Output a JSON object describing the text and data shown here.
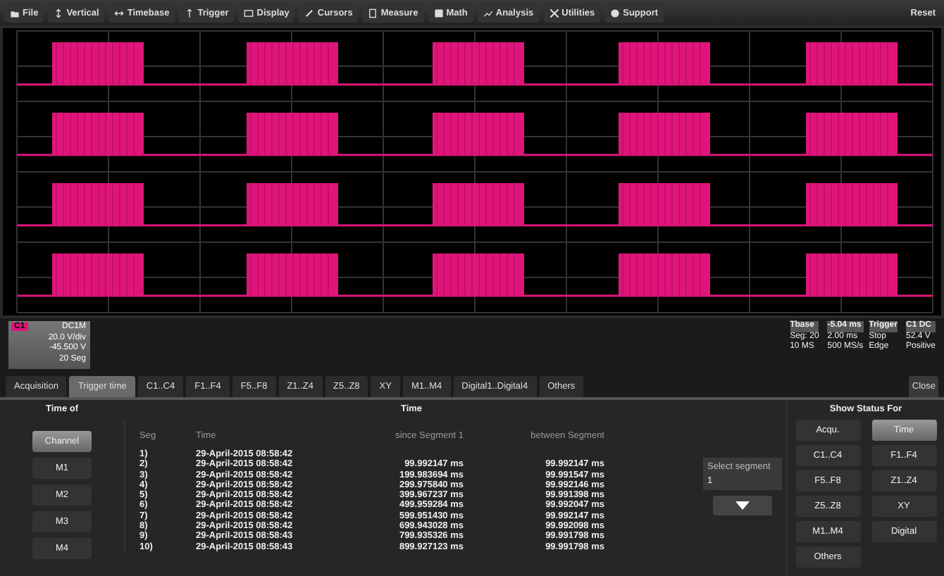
{
  "menu": [
    "File",
    "Vertical",
    "Timebase",
    "Trigger",
    "Display",
    "Cursors",
    "Measure",
    "Math",
    "Analysis",
    "Utilities",
    "Support"
  ],
  "reset": "Reset",
  "traces": [
    {
      "color": "#e0157a"
    },
    {
      "color": "#e0157a"
    },
    {
      "color": "#e0157a"
    },
    {
      "color": "#e0157a"
    }
  ],
  "channel": {
    "badge": "C1",
    "color": "#e0157a",
    "lines": [
      "DC1M",
      "20.0 V/div",
      "-45.500 V",
      "20 Seg"
    ]
  },
  "timebase": {
    "rows": [
      [
        "Tbase",
        "-5.04 ms"
      ],
      [
        "Seg: 20",
        "2.00 ms"
      ],
      [
        "10 MS",
        "500 MS/s"
      ]
    ]
  },
  "trigger": {
    "rows": [
      [
        "Trigger",
        "C1 DC"
      ],
      [
        "Stop",
        "52.4 V"
      ],
      [
        "Edge",
        "Positive"
      ]
    ]
  },
  "tabs": [
    {
      "label": "Acquisition",
      "selected": false
    },
    {
      "label": "Trigger time",
      "selected": true
    },
    {
      "label": "C1..C4",
      "selected": false
    },
    {
      "label": "F1..F4",
      "selected": false
    },
    {
      "label": "F5..F8",
      "selected": false
    },
    {
      "label": "Z1..Z4",
      "selected": false
    },
    {
      "label": "Z5..Z8",
      "selected": false
    },
    {
      "label": "XY",
      "selected": false
    },
    {
      "label": "M1..M4",
      "selected": false
    },
    {
      "label": "Digital1..Digital4",
      "selected": false
    },
    {
      "label": "Others",
      "selected": false
    }
  ],
  "close": "Close",
  "time_of": {
    "title": "Time of",
    "buttons": [
      {
        "label": "Channel",
        "selected": true
      },
      {
        "label": "M1",
        "selected": false
      },
      {
        "label": "M2",
        "selected": false
      },
      {
        "label": "M3",
        "selected": false
      },
      {
        "label": "M4",
        "selected": false
      }
    ]
  },
  "table": {
    "title": "Time",
    "columns": [
      "Seg",
      "Time",
      "since Segment 1",
      "between Segment"
    ],
    "rows": [
      [
        "1)",
        "29-April-2015  08:58:42",
        "",
        ""
      ],
      [
        "2)",
        "29-April-2015  08:58:42",
        "99.992147 ms",
        "99.992147 ms"
      ],
      [
        "3)",
        "29-April-2015  08:58:42",
        "199.983694 ms",
        "99.991547 ms"
      ],
      [
        "4)",
        "29-April-2015  08:58:42",
        "299.975840 ms",
        "99.992146 ms"
      ],
      [
        "5)",
        "29-April-2015  08:58:42",
        "399.967237 ms",
        "99.991398 ms"
      ],
      [
        "6)",
        "29-April-2015  08:58:42",
        "499.959284 ms",
        "99.992047 ms"
      ],
      [
        "7)",
        "29-April-2015  08:58:42",
        "599.951430 ms",
        "99.992147 ms"
      ],
      [
        "8)",
        "29-April-2015  08:58:42",
        "699.943028 ms",
        "99.992098 ms"
      ],
      [
        "9)",
        "29-April-2015  08:58:43",
        "799.935326 ms",
        "99.991798 ms"
      ],
      [
        "10)",
        "29-April-2015  08:58:43",
        "899.927123 ms",
        "99.991798 ms"
      ]
    ]
  },
  "select_segment": {
    "label": "Select segment",
    "value": "1"
  },
  "status": {
    "title": "Show Status For",
    "buttons": [
      {
        "label": "Acqu.",
        "selected": false
      },
      {
        "label": "Time",
        "selected": true
      },
      {
        "label": "C1..C4",
        "selected": false
      },
      {
        "label": "F1..F4",
        "selected": false
      },
      {
        "label": "F5..F8",
        "selected": false
      },
      {
        "label": "Z1..Z4",
        "selected": false
      },
      {
        "label": "Z5..Z8",
        "selected": false
      },
      {
        "label": "XY",
        "selected": false
      },
      {
        "label": "M1..M4",
        "selected": false
      },
      {
        "label": "Digital",
        "selected": false
      },
      {
        "label": "Others",
        "selected": false
      }
    ]
  }
}
